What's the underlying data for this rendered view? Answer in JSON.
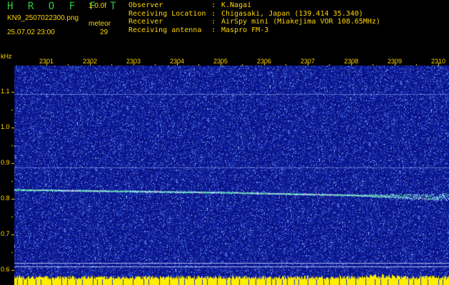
{
  "header": {
    "brand": "H R O F F T",
    "version": "1.0.0f",
    "filename": "KN9_2507022300.png",
    "mode": "meteor",
    "datetime": "25.07.02 23:00",
    "count": "29",
    "info": [
      {
        "key": "Observer",
        "value": "K.Nagai"
      },
      {
        "key": "Receiving Location",
        "value": "Chigasaki, Japan (139.414 35.340)"
      },
      {
        "key": "Receiver",
        "value": "AirSpy mini (Miakejima VOR 108.65MHz)"
      },
      {
        "key": "Receiving antenna",
        "value": "Maspro FM-3"
      }
    ]
  },
  "chart_data": {
    "type": "heatmap",
    "title": "",
    "ylabel": "kHz",
    "yticks": [
      "1.1",
      "1.0",
      "0.9",
      "0.8",
      "0.7",
      "0.6"
    ],
    "xticks": [
      "2301",
      "2302",
      "2303",
      "2304",
      "2305",
      "2306",
      "2307",
      "2308",
      "2309",
      "2310"
    ],
    "ylim": [
      0.58,
      1.18
    ],
    "carrier_trace": [
      {
        "x": "2300",
        "y": 0.826
      },
      {
        "x": "2305",
        "y": 0.818
      },
      {
        "x": "2310",
        "y": 0.805
      }
    ],
    "horizontal_lines_khz": [
      1.095,
      0.888,
      0.62,
      0.61
    ],
    "colors": {
      "background": "#0b1590",
      "noise": "#6fa0ff",
      "trace": "#39d37a",
      "baseline": "#ffee00"
    }
  }
}
